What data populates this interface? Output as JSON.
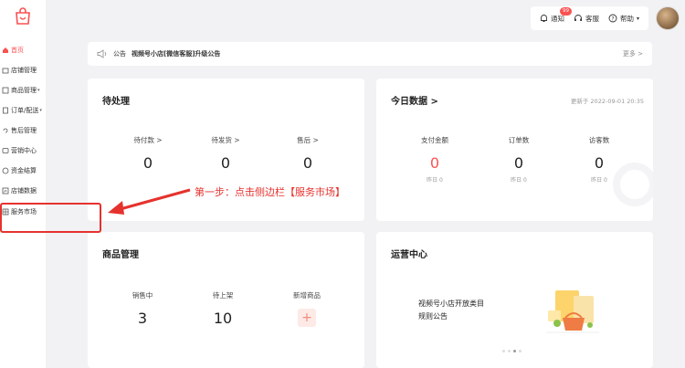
{
  "sidebar": {
    "items": [
      {
        "label": "首页",
        "icon": "home-icon",
        "active": true
      },
      {
        "label": "店铺管理",
        "icon": "store-icon"
      },
      {
        "label": "商品管理",
        "icon": "product-icon",
        "caret": true
      },
      {
        "label": "订单/配送",
        "icon": "order-icon",
        "caret": true
      },
      {
        "label": "售后管理",
        "icon": "aftersale-icon"
      },
      {
        "label": "营销中心",
        "icon": "marketing-icon"
      },
      {
        "label": "资金结算",
        "icon": "funds-icon"
      },
      {
        "label": "店铺数据",
        "icon": "data-icon"
      },
      {
        "label": "服务市场",
        "icon": "service-icon"
      }
    ]
  },
  "topbar": {
    "notify_label": "通知",
    "notify_badge": "99",
    "support_label": "客服",
    "help_label": "帮助"
  },
  "notice": {
    "tag": "公告",
    "title": "视频号小店[微信客服]升级公告",
    "more": "更多 >"
  },
  "pending": {
    "title": "待处理",
    "stats": [
      {
        "label": "待付款 >",
        "value": "0"
      },
      {
        "label": "待发货 >",
        "value": "0"
      },
      {
        "label": "售后 >",
        "value": "0"
      }
    ]
  },
  "today": {
    "title": "今日数据 >",
    "updated": "更新于 2022-09-01 20:35",
    "stats": [
      {
        "label": "支付金额",
        "value": "0",
        "sub": "昨日 0"
      },
      {
        "label": "订单数",
        "value": "0",
        "sub": "昨日 0"
      },
      {
        "label": "访客数",
        "value": "0",
        "sub": "昨日 0"
      }
    ]
  },
  "products": {
    "title": "商品管理",
    "stats": [
      {
        "label": "销售中",
        "value": "3"
      },
      {
        "label": "待上架",
        "value": "10"
      },
      {
        "label": "新增商品",
        "value": "+"
      }
    ]
  },
  "ops": {
    "title": "运营中心",
    "line1": "视频号小店开放类目",
    "line2": "规则公告"
  },
  "annotation": "第一步：点击侧边栏【服务市场】",
  "colors": {
    "accent": "#fa5151",
    "annotation": "#e5322d"
  }
}
